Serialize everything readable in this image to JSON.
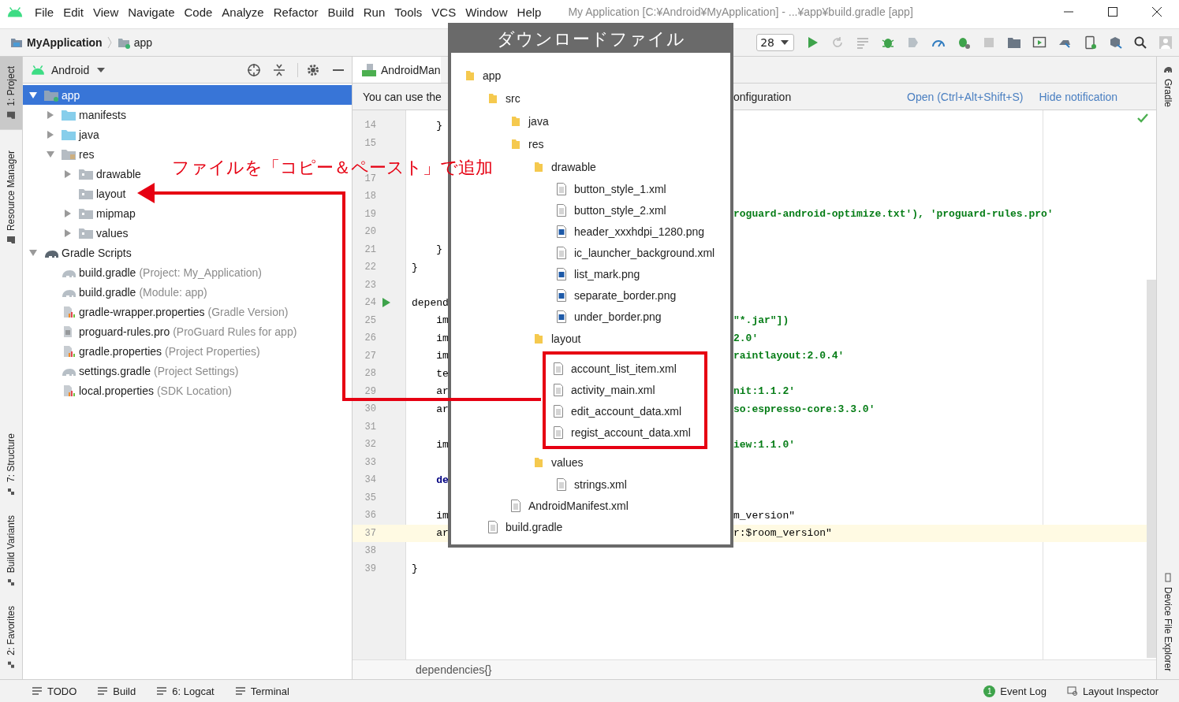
{
  "window": {
    "title": "My Application [C:¥Android¥MyApplication] - ...¥app¥build.gradle [app]"
  },
  "menu": [
    "File",
    "Edit",
    "View",
    "Navigate",
    "Code",
    "Analyze",
    "Refactor",
    "Build",
    "Run",
    "Tools",
    "VCS",
    "Window",
    "Help"
  ],
  "toolbar": {
    "breadcrumbs": [
      "MyApplication",
      "app"
    ],
    "api_dropdown": "28"
  },
  "left_strip": [
    {
      "label": "1: Project",
      "selected": true
    },
    {
      "label": "Resource Manager",
      "selected": false
    },
    {
      "label": "7: Structure",
      "selected": false
    },
    {
      "label": "Build Variants",
      "selected": false
    },
    {
      "label": "2: Favorites",
      "selected": false
    }
  ],
  "project": {
    "view": "Android",
    "tree": [
      {
        "name": "app",
        "kind": "module",
        "expanded": true,
        "selected": true,
        "children": [
          {
            "name": "manifests",
            "kind": "folder-blue",
            "expanded": false,
            "selected": false
          },
          {
            "name": "java",
            "kind": "folder-blue",
            "expanded": false,
            "selected": false
          },
          {
            "name": "res",
            "kind": "folder-res",
            "expanded": true,
            "selected": false,
            "children": [
              {
                "name": "drawable",
                "kind": "folder",
                "expanded": false,
                "selected": false
              },
              {
                "name": "layout",
                "kind": "folder",
                "selected": false
              },
              {
                "name": "mipmap",
                "kind": "folder",
                "expanded": false,
                "selected": false
              },
              {
                "name": "values",
                "kind": "folder",
                "expanded": false,
                "selected": false
              }
            ]
          }
        ]
      },
      {
        "name": "Gradle Scripts",
        "kind": "gradle",
        "expanded": true,
        "selected": false,
        "children": [
          {
            "name": "build.gradle",
            "hint": "(Project: My_Application)",
            "kind": "gradle-file",
            "selected": false
          },
          {
            "name": "build.gradle",
            "hint": "(Module: app)",
            "kind": "gradle-file",
            "selected": false
          },
          {
            "name": "gradle-wrapper.properties",
            "hint": "(Gradle Version)",
            "kind": "properties",
            "selected": false
          },
          {
            "name": "proguard-rules.pro",
            "hint": "(ProGuard Rules for app)",
            "kind": "text",
            "selected": false
          },
          {
            "name": "gradle.properties",
            "hint": "(Project Properties)",
            "kind": "properties",
            "selected": false
          },
          {
            "name": "settings.gradle",
            "hint": "(Project Settings)",
            "kind": "gradle-file",
            "selected": false
          },
          {
            "name": "local.properties",
            "hint": "(SDK Location)",
            "kind": "properties",
            "selected": false
          }
        ]
      }
    ]
  },
  "editor": {
    "tab": "AndroidMan",
    "notification": {
      "text": "You can use the",
      "text_right": "onfiguration",
      "links": [
        "Open (Ctrl+Alt+Shift+S)",
        "Hide notification"
      ]
    },
    "lines": [
      {
        "n": "14",
        "left": "    }",
        "current": false,
        "run": false,
        "keyword": false
      },
      {
        "n": "15",
        "current": false,
        "run": false
      },
      {
        "current": false,
        "run": false
      },
      {
        "n": "17",
        "current": false,
        "run": false
      },
      {
        "n": "18",
        "current": false,
        "run": false
      },
      {
        "n": "19",
        "right": "roguard-android-optimize.txt'), 'proguard-rules.pro'",
        "string": true,
        "current": false,
        "run": false
      },
      {
        "n": "20",
        "current": false,
        "run": false
      },
      {
        "n": "21",
        "left": "    }",
        "current": false,
        "run": false,
        "keyword": false
      },
      {
        "n": "22",
        "left": "}",
        "current": false,
        "run": false,
        "keyword": false
      },
      {
        "n": "23",
        "current": false,
        "run": false
      },
      {
        "n": "24",
        "left": "depend",
        "current": false,
        "run": true,
        "keyword": false
      },
      {
        "n": "25",
        "left": "    im",
        "right": "\"*.jar\"])",
        "string": true,
        "current": false,
        "run": false,
        "keyword": false
      },
      {
        "n": "26",
        "left": "    im",
        "right": "2.0'",
        "string": true,
        "current": false,
        "run": false,
        "keyword": false
      },
      {
        "n": "27",
        "left": "    im",
        "right": "raintlayout:2.0.4'",
        "string": true,
        "current": false,
        "run": false,
        "keyword": false
      },
      {
        "n": "28",
        "left": "    te",
        "current": false,
        "run": false,
        "keyword": false
      },
      {
        "n": "29",
        "left": "    ar",
        "right": "nit:1.1.2'",
        "string": true,
        "current": false,
        "run": false,
        "keyword": false
      },
      {
        "n": "30",
        "left": "    ar",
        "right": "so:espresso-core:3.3.0'",
        "string": true,
        "current": false,
        "run": false,
        "keyword": false
      },
      {
        "n": "31",
        "current": false,
        "run": false
      },
      {
        "n": "32",
        "left": "    im",
        "right": "iew:1.1.0'",
        "string": true,
        "current": false,
        "run": false,
        "keyword": false
      },
      {
        "n": "33",
        "current": false,
        "run": false
      },
      {
        "n": "34",
        "left": "    de",
        "current": false,
        "run": false,
        "keyword": true
      },
      {
        "n": "35",
        "current": false,
        "run": false
      },
      {
        "n": "36",
        "left": "    im",
        "right": "m_version\"",
        "string": false,
        "current": false,
        "run": false,
        "keyword": false
      },
      {
        "n": "37",
        "left": "    ar",
        "right": "r:$room_version\"",
        "string": false,
        "current": true,
        "run": false,
        "keyword": false
      },
      {
        "n": "38",
        "current": false,
        "run": false
      },
      {
        "n": "39",
        "left": "}",
        "current": false,
        "run": false,
        "keyword": false
      }
    ],
    "breadcrumb": "dependencies{}"
  },
  "right_strip": [
    "Gradle",
    "Device File Explorer"
  ],
  "status_bar": {
    "left": [
      "TODO",
      "Build",
      "6: Logcat",
      "Terminal"
    ],
    "right": [
      {
        "label": "Event Log",
        "badge": "1"
      },
      {
        "label": "Layout Inspector"
      }
    ]
  },
  "overlay": {
    "title": "ダウンロードファイル",
    "tree": [
      {
        "name": "app",
        "kind": "folder",
        "framed": false,
        "children": [
          {
            "name": "src",
            "kind": "folder",
            "framed": false,
            "children": [
              {
                "name": "java",
                "kind": "folder"
              },
              {
                "name": "res",
                "kind": "folder",
                "framed": false,
                "children": [
                  {
                    "name": "drawable",
                    "kind": "folder",
                    "framed": false,
                    "children": [
                      {
                        "name": "button_style_1.xml",
                        "kind": "file"
                      },
                      {
                        "name": "button_style_2.xml",
                        "kind": "file"
                      },
                      {
                        "name": "header_xxxhdpi_1280.png",
                        "kind": "image"
                      },
                      {
                        "name": "ic_launcher_background.xml",
                        "kind": "file"
                      },
                      {
                        "name": "list_mark.png",
                        "kind": "image"
                      },
                      {
                        "name": "separate_border.png",
                        "kind": "image"
                      },
                      {
                        "name": "under_border.png",
                        "kind": "image"
                      }
                    ]
                  },
                  {
                    "name": "layout",
                    "kind": "folder",
                    "framed": true,
                    "children": [
                      {
                        "name": "account_list_item.xml",
                        "kind": "file"
                      },
                      {
                        "name": "activity_main.xml",
                        "kind": "file"
                      },
                      {
                        "name": "edit_account_data.xml",
                        "kind": "file"
                      },
                      {
                        "name": "regist_account_data.xml",
                        "kind": "file"
                      }
                    ]
                  },
                  {
                    "name": "values",
                    "kind": "folder",
                    "framed": false,
                    "children": [
                      {
                        "name": "strings.xml",
                        "kind": "file"
                      }
                    ]
                  }
                ]
              },
              {
                "name": "AndroidManifest.xml",
                "kind": "file"
              }
            ]
          },
          {
            "name": "build.gradle",
            "kind": "file"
          }
        ]
      }
    ]
  },
  "annotation": {
    "text": "ファイルを「コピー＆ペースト」で追加"
  }
}
